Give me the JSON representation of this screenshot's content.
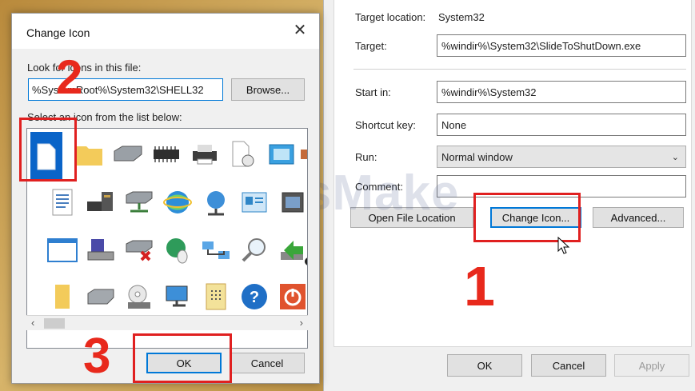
{
  "properties": {
    "target_location_label": "Target location:",
    "target_location_value": "System32",
    "target_label": "Target:",
    "target_value": "%windir%\\System32\\SlideToShutDown.exe",
    "start_in_label": "Start in:",
    "start_in_value": "%windir%\\System32",
    "shortcut_key_label": "Shortcut key:",
    "shortcut_key_value": "None",
    "run_label": "Run:",
    "run_value": "Normal window",
    "comment_label": "Comment:",
    "comment_value": "",
    "open_file_location": "Open File Location",
    "change_icon": "Change Icon...",
    "advanced": "Advanced...",
    "ok": "OK",
    "cancel": "Cancel",
    "apply": "Apply"
  },
  "change_icon_dialog": {
    "title": "Change Icon",
    "look_for_label": "Look for icons in this file:",
    "path_value": "%SystemRoot%\\System32\\SHELL32",
    "browse": "Browse...",
    "select_label": "Select an icon from the list below:",
    "ok": "OK",
    "cancel": "Cancel"
  },
  "annotations": {
    "step1": "1",
    "step2": "2",
    "step3": "3",
    "color": "#e8291c"
  },
  "watermark": "TipsMake"
}
